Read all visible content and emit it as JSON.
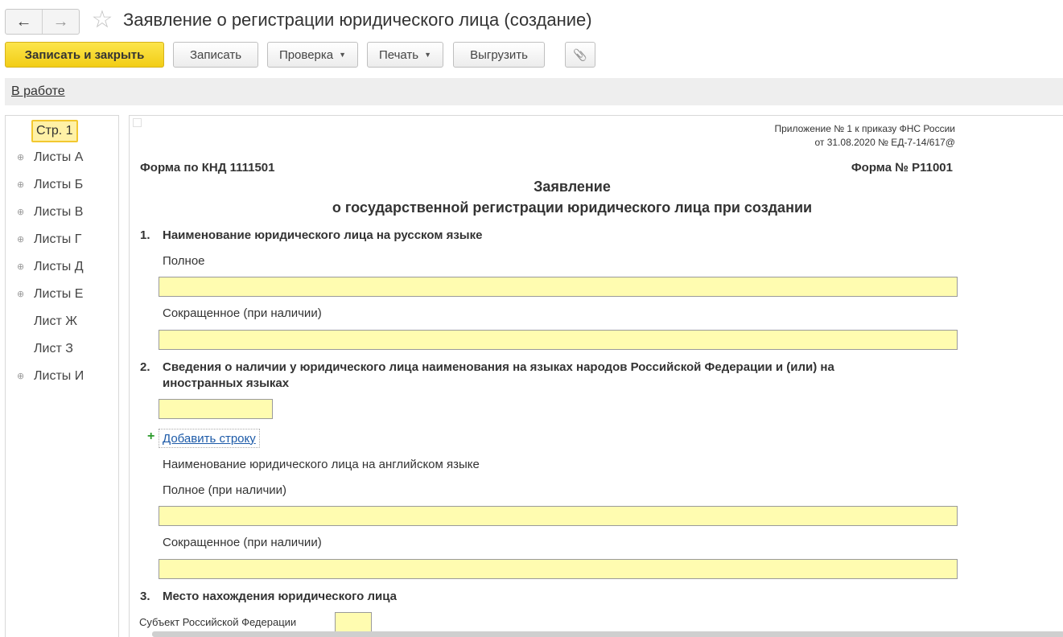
{
  "window": {
    "title": "Заявление о регистрации юридического лица (создание)",
    "back_icon": "←",
    "forward_icon": "→",
    "star_icon": "☆"
  },
  "toolbar": {
    "save_close": "Записать и закрыть",
    "save": "Записать",
    "check": "Проверка",
    "print": "Печать",
    "export": "Выгрузить",
    "dropdown_arrow": "▼",
    "attach_icon": "📎"
  },
  "status": {
    "label": "В работе"
  },
  "sidebar": {
    "expander": "⊕",
    "items": [
      {
        "label": "Стр. 1"
      },
      {
        "label": "Листы А"
      },
      {
        "label": "Листы Б"
      },
      {
        "label": "Листы В"
      },
      {
        "label": "Листы Г"
      },
      {
        "label": "Листы Д"
      },
      {
        "label": "Листы Е"
      },
      {
        "label": "Лист Ж"
      },
      {
        "label": "Лист З"
      },
      {
        "label": "Листы И"
      }
    ]
  },
  "doc": {
    "appendix_line1": "Приложение № 1 к приказу ФНС России",
    "appendix_line2": "от 31.08.2020 № ЕД-7-14/617@",
    "form_knd": "Форма по КНД 1111501",
    "form_number": "Форма № Р11001",
    "title_line1": "Заявление",
    "title_line2": "о государственной регистрации юридического лица при создании",
    "section1": {
      "num": "1.",
      "title": "Наименование юридического лица на русском языке",
      "full_label": "Полное",
      "full_value": "",
      "short_label": "Сокращенное (при наличии)",
      "short_value": ""
    },
    "section2": {
      "num": "2.",
      "title_line1": "Сведения о наличии у юридического лица наименования на языках народов Российской Федерации и (или) на",
      "title_line2": "иностранных языках",
      "lang_value": "",
      "add_plus": "+",
      "add_row": "Добавить строку",
      "english_label": "Наименование юридического лица на английском языке",
      "full_label": "Полное (при наличии)",
      "full_value": "",
      "short_label": "Сокращенное (при наличии)",
      "short_value": ""
    },
    "section3": {
      "num": "3.",
      "title": "Место нахождения юридического лица",
      "subject_label": "Субъект Российской Федерации",
      "subject_value": ""
    }
  }
}
